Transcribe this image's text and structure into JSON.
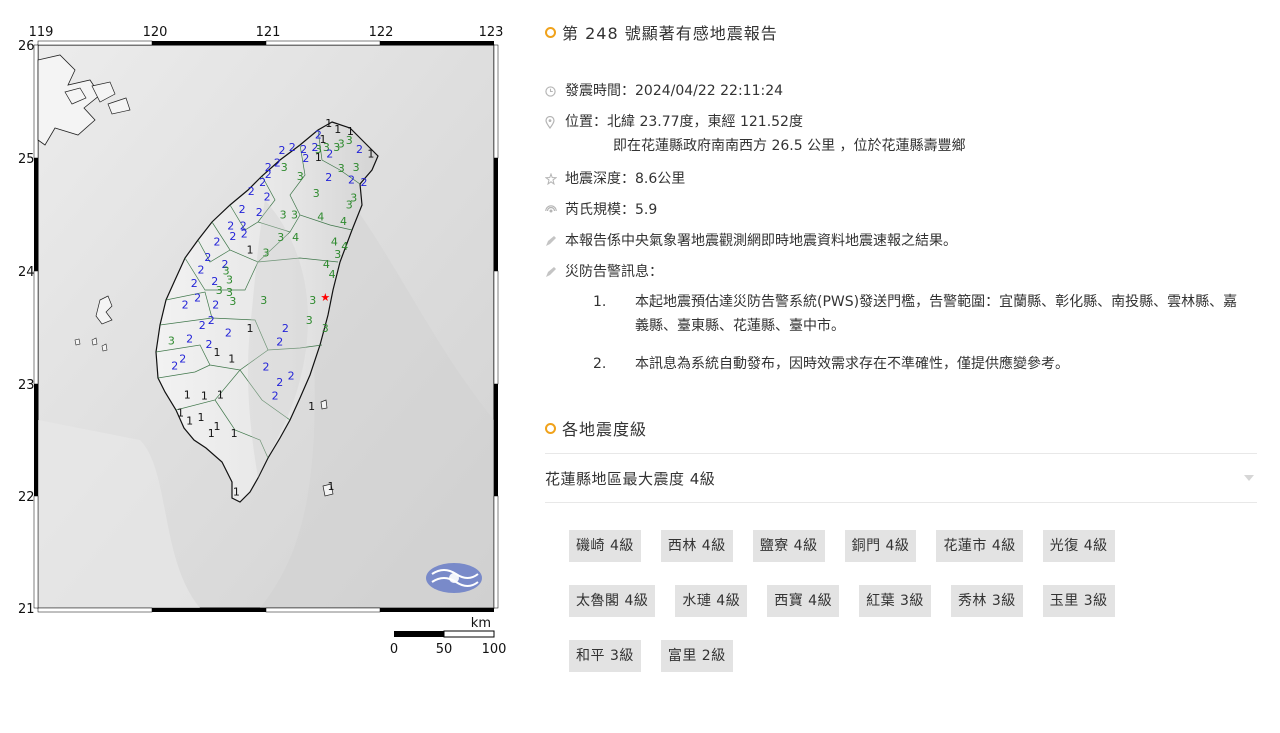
{
  "map": {
    "lon_ticks": [
      "119",
      "120",
      "121",
      "122",
      "123"
    ],
    "lat_ticks": [
      "26",
      "25",
      "24",
      "23",
      "22",
      "21"
    ],
    "scale": {
      "unit": "km",
      "labels": [
        "0",
        "50",
        "100"
      ]
    },
    "logo_name": "central-weather-administration-logo",
    "intensity_colors": {
      "1": "#111111",
      "2": "#2323d8",
      "3": "#2e8a2e",
      "4": "#2e8a2e"
    },
    "epicenter_color": "#ff0000",
    "markers": [
      {
        "v": "1",
        "lon": 121.55,
        "lat": 25.27
      },
      {
        "v": "1",
        "lon": 121.63,
        "lat": 25.22
      },
      {
        "v": "1",
        "lon": 121.74,
        "lat": 25.2
      },
      {
        "v": "2",
        "lon": 121.46,
        "lat": 25.17
      },
      {
        "v": "1",
        "lon": 121.5,
        "lat": 25.13
      },
      {
        "v": "2",
        "lon": 121.43,
        "lat": 25.06
      },
      {
        "v": "2",
        "lon": 121.33,
        "lat": 25.04
      },
      {
        "v": "2",
        "lon": 121.23,
        "lat": 25.06
      },
      {
        "v": "2",
        "lon": 121.14,
        "lat": 25.03
      },
      {
        "v": "3",
        "lon": 121.53,
        "lat": 25.06
      },
      {
        "v": "3",
        "lon": 121.46,
        "lat": 25.04
      },
      {
        "v": "3",
        "lon": 121.62,
        "lat": 25.06
      },
      {
        "v": "3",
        "lon": 121.73,
        "lat": 25.12
      },
      {
        "v": "3",
        "lon": 121.66,
        "lat": 25.09
      },
      {
        "v": "2",
        "lon": 121.82,
        "lat": 25.04
      },
      {
        "v": "1",
        "lon": 121.92,
        "lat": 25.0
      },
      {
        "v": "2",
        "lon": 121.56,
        "lat": 25.0
      },
      {
        "v": "1",
        "lon": 121.46,
        "lat": 24.97
      },
      {
        "v": "2",
        "lon": 121.35,
        "lat": 24.96
      },
      {
        "v": "2",
        "lon": 121.1,
        "lat": 24.92
      },
      {
        "v": "3",
        "lon": 121.16,
        "lat": 24.88
      },
      {
        "v": "2",
        "lon": 121.02,
        "lat": 24.88
      },
      {
        "v": "2",
        "lon": 121.02,
        "lat": 24.82
      },
      {
        "v": "3",
        "lon": 121.3,
        "lat": 24.8
      },
      {
        "v": "3",
        "lon": 121.66,
        "lat": 24.87
      },
      {
        "v": "3",
        "lon": 121.79,
        "lat": 24.88
      },
      {
        "v": "2",
        "lon": 121.55,
        "lat": 24.79
      },
      {
        "v": "2",
        "lon": 121.75,
        "lat": 24.77
      },
      {
        "v": "2",
        "lon": 121.86,
        "lat": 24.75
      },
      {
        "v": "2",
        "lon": 120.97,
        "lat": 24.75
      },
      {
        "v": "2",
        "lon": 120.87,
        "lat": 24.67
      },
      {
        "v": "2",
        "lon": 121.01,
        "lat": 24.62
      },
      {
        "v": "3",
        "lon": 121.44,
        "lat": 24.65
      },
      {
        "v": "3",
        "lon": 121.77,
        "lat": 24.61
      },
      {
        "v": "3",
        "lon": 121.73,
        "lat": 24.55
      },
      {
        "v": "2",
        "lon": 120.79,
        "lat": 24.51
      },
      {
        "v": "2",
        "lon": 120.94,
        "lat": 24.48
      },
      {
        "v": "3",
        "lon": 121.15,
        "lat": 24.46
      },
      {
        "v": "3",
        "lon": 121.25,
        "lat": 24.46
      },
      {
        "v": "4",
        "lon": 121.48,
        "lat": 24.44
      },
      {
        "v": "4",
        "lon": 121.68,
        "lat": 24.4
      },
      {
        "v": "2",
        "lon": 120.69,
        "lat": 24.36
      },
      {
        "v": "2",
        "lon": 120.8,
        "lat": 24.36
      },
      {
        "v": "2",
        "lon": 120.71,
        "lat": 24.27
      },
      {
        "v": "2",
        "lon": 120.81,
        "lat": 24.29
      },
      {
        "v": "2",
        "lon": 120.57,
        "lat": 24.22
      },
      {
        "v": "3",
        "lon": 121.13,
        "lat": 24.26
      },
      {
        "v": "4",
        "lon": 121.26,
        "lat": 24.26
      },
      {
        "v": "4",
        "lon": 121.6,
        "lat": 24.22
      },
      {
        "v": "4",
        "lon": 121.69,
        "lat": 24.18
      },
      {
        "v": "3",
        "lon": 121.63,
        "lat": 24.11
      },
      {
        "v": "1",
        "lon": 120.86,
        "lat": 24.15
      },
      {
        "v": "3",
        "lon": 121.0,
        "lat": 24.12
      },
      {
        "v": "2",
        "lon": 120.49,
        "lat": 24.08
      },
      {
        "v": "2",
        "lon": 120.64,
        "lat": 24.02
      },
      {
        "v": "4",
        "lon": 121.53,
        "lat": 24.02
      },
      {
        "v": "2",
        "lon": 120.43,
        "lat": 23.97
      },
      {
        "v": "3",
        "lon": 120.65,
        "lat": 23.96
      },
      {
        "v": "4",
        "lon": 121.58,
        "lat": 23.93
      },
      {
        "v": "2",
        "lon": 120.37,
        "lat": 23.85
      },
      {
        "v": "2",
        "lon": 120.55,
        "lat": 23.87
      },
      {
        "v": "3",
        "lon": 120.68,
        "lat": 23.88
      },
      {
        "v": "3",
        "lon": 120.59,
        "lat": 23.79
      },
      {
        "v": "3",
        "lon": 120.68,
        "lat": 23.77
      },
      {
        "v": "3",
        "lon": 120.71,
        "lat": 23.69
      },
      {
        "v": "3",
        "lon": 120.98,
        "lat": 23.7
      },
      {
        "v": "3",
        "lon": 121.41,
        "lat": 23.7
      },
      {
        "v": "2",
        "lon": 120.4,
        "lat": 23.72
      },
      {
        "v": "2",
        "lon": 120.56,
        "lat": 23.66
      },
      {
        "v": "2",
        "lon": 120.29,
        "lat": 23.66
      },
      {
        "v": "2",
        "lon": 120.52,
        "lat": 23.52
      },
      {
        "v": "2",
        "lon": 120.44,
        "lat": 23.48
      },
      {
        "v": "3",
        "lon": 121.38,
        "lat": 23.52
      },
      {
        "v": "3",
        "lon": 121.52,
        "lat": 23.45
      },
      {
        "v": "2",
        "lon": 120.67,
        "lat": 23.41
      },
      {
        "v": "1",
        "lon": 120.86,
        "lat": 23.45
      },
      {
        "v": "2",
        "lon": 121.17,
        "lat": 23.45
      },
      {
        "v": "3",
        "lon": 120.17,
        "lat": 23.34
      },
      {
        "v": "2",
        "lon": 120.33,
        "lat": 23.36
      },
      {
        "v": "2",
        "lon": 120.5,
        "lat": 23.31
      },
      {
        "v": "1",
        "lon": 120.57,
        "lat": 23.24
      },
      {
        "v": "1",
        "lon": 120.7,
        "lat": 23.18
      },
      {
        "v": "2",
        "lon": 121.12,
        "lat": 23.33
      },
      {
        "v": "2",
        "lon": 120.27,
        "lat": 23.18
      },
      {
        "v": "2",
        "lon": 120.2,
        "lat": 23.12
      },
      {
        "v": "2",
        "lon": 121.0,
        "lat": 23.11
      },
      {
        "v": "2",
        "lon": 121.22,
        "lat": 23.03
      },
      {
        "v": "2",
        "lon": 121.12,
        "lat": 22.97
      },
      {
        "v": "2",
        "lon": 121.08,
        "lat": 22.85
      },
      {
        "v": "1",
        "lon": 120.31,
        "lat": 22.86
      },
      {
        "v": "1",
        "lon": 120.46,
        "lat": 22.85
      },
      {
        "v": "1",
        "lon": 120.6,
        "lat": 22.86
      },
      {
        "v": "1",
        "lon": 120.33,
        "lat": 22.63
      },
      {
        "v": "1",
        "lon": 120.43,
        "lat": 22.66
      },
      {
        "v": "1",
        "lon": 120.25,
        "lat": 22.7
      },
      {
        "v": "1",
        "lon": 120.57,
        "lat": 22.58
      },
      {
        "v": "1",
        "lon": 120.52,
        "lat": 22.52
      },
      {
        "v": "1",
        "lon": 120.72,
        "lat": 22.52
      },
      {
        "v": "1",
        "lon": 121.4,
        "lat": 22.76
      },
      {
        "v": "1",
        "lon": 120.74,
        "lat": 22.0
      },
      {
        "v": "1",
        "lon": 121.57,
        "lat": 22.05
      }
    ],
    "epicenter": {
      "lon": 121.52,
      "lat": 23.77
    }
  },
  "report": {
    "title": "第 248 號顯著有感地震報告",
    "time": "發震時間：2024/04/22 22:11:24",
    "location": "位置：北緯 23.77度，東經 121.52度",
    "location_detail": "即在花蓮縣政府南南西方 26.5 公里 ，位於花蓮縣壽豐鄉",
    "depth": "地震深度：8.6公里",
    "magnitude": "芮氏規模：5.9",
    "source_note": "本報告係中央氣象署地震觀測網即時地震資料地震速報之結果。",
    "warning_heading": "災防告警訊息：",
    "warnings": [
      {
        "num": "1.",
        "text": "本起地震預估達災防告警系統(PWS)發送門檻，告警範圍：宜蘭縣、彰化縣、南投縣、雲林縣、嘉義縣、臺東縣、花蓮縣、臺中市。"
      },
      {
        "num": "2.",
        "text": "本訊息為系統自動發布，因時效需求存在不準確性，僅提供應變參考。"
      }
    ],
    "icons": [
      "clock-icon",
      "location-pin-icon",
      "depth-icon",
      "magnitude-icon",
      "note-icon",
      "note-icon"
    ]
  },
  "intensity": {
    "title": "各地震度級",
    "region": "花蓮縣地區最大震度 4級",
    "stations": [
      "磯崎 4級",
      "西林 4級",
      "鹽寮 4級",
      "銅門 4級",
      "花蓮市 4級",
      "光復 4級",
      "太魯閣 4級",
      "水璉 4級",
      "西寶 4級",
      "紅葉 3級",
      "秀林 3級",
      "玉里 3級",
      "和平 3級",
      "富里 2級"
    ]
  }
}
